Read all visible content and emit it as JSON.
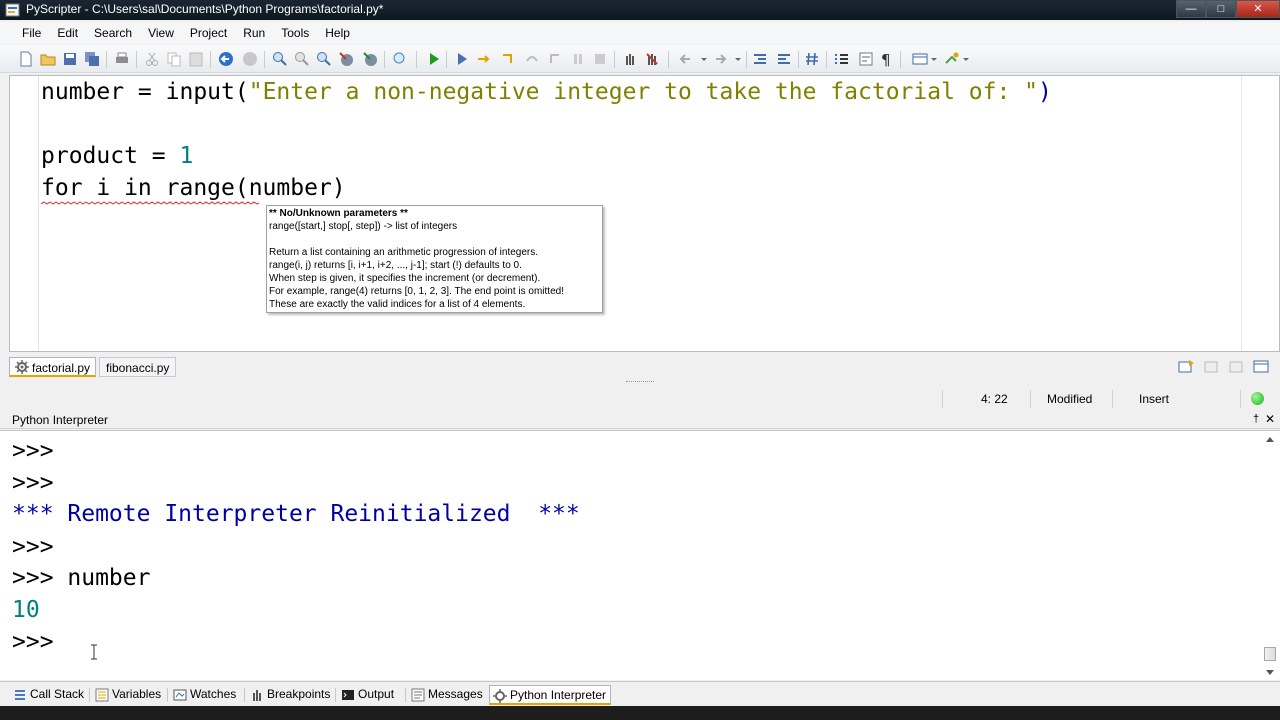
{
  "window": {
    "title": "PyScripter - C:\\Users\\sal\\Documents\\Python Programs\\factorial.py*",
    "min_glyph": "—",
    "max_glyph": "□",
    "close_glyph": "✕"
  },
  "menu": [
    "File",
    "Edit",
    "Search",
    "View",
    "Project",
    "Run",
    "Tools",
    "Help"
  ],
  "editor": {
    "lines": [
      {
        "a": "number = input(",
        "b": "\"Enter a non-negative integer to take the factorial of: \"",
        "c": ")"
      },
      {
        "a": "product = ",
        "b": "1"
      },
      {
        "a": "for i in range(number)"
      }
    ]
  },
  "hint": {
    "title": "** No/Unknown parameters **",
    "signature": "range([start,] stop[, step]) -> list of integers",
    "body": [
      "Return a list containing an arithmetic progression of integers.",
      "range(i, j) returns [i, i+1, i+2, ..., j-1]; start (!) defaults to 0.",
      "When step is given, it specifies the increment (or decrement).",
      "For example, range(4) returns [0, 1, 2, 3].  The end point is omitted!",
      "These are exactly the valid indices for a list of 4 elements."
    ]
  },
  "doc_tabs": [
    "factorial.py",
    "fibonacci.py"
  ],
  "status": {
    "position": "4: 22",
    "modified": "Modified",
    "mode": "Insert"
  },
  "interpreter": {
    "panel_title": "Python Interpreter",
    "pin_glyph": "†",
    "close_glyph": "✕",
    "lines": [
      ">>>",
      ">>>",
      "*** Remote Interpreter Reinitialized  ***",
      ">>>",
      ">>> number",
      "10",
      ">>>"
    ]
  },
  "bottom_tabs": [
    "Call Stack",
    "Variables",
    "Watches",
    "Breakpoints",
    "Output",
    "Messages",
    "Python Interpreter"
  ],
  "colors": {
    "string": "#808000",
    "number": "#008080",
    "banner": "#0000a0",
    "tab_accent": "#e8a400"
  }
}
